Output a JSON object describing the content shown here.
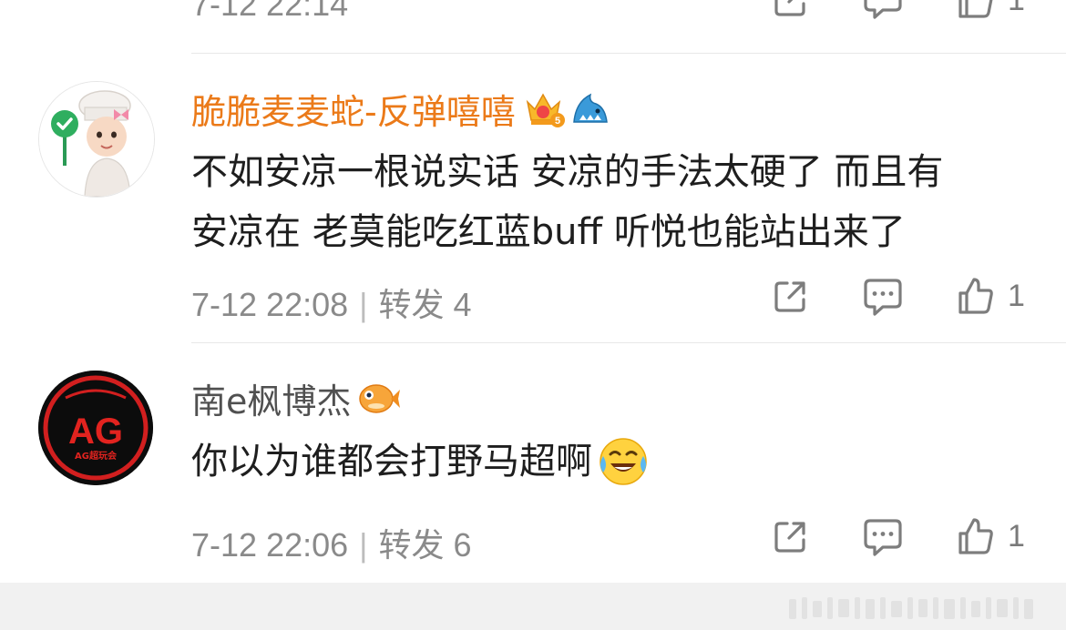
{
  "top_comment": {
    "time": "7-12 22:14",
    "likes": "1"
  },
  "comments": [
    {
      "username": "脆脆麦麦蛇-反弹嘻嘻",
      "username_color": "#eb7a19",
      "badges": [
        "crown-5-badge-icon",
        "shark-badge-icon"
      ],
      "text_line1": "不如安凉一根说实话 安凉的手法太硬了 而且有",
      "text_line2": "安凉在 老莫能吃红蓝buff 听悦也能站出来了",
      "time": "7-12 22:08",
      "repost_label": "转发 4",
      "likes": "1"
    },
    {
      "username": "南e枫博杰",
      "username_color": "#505050",
      "badges": [
        "pufferfish-badge-icon"
      ],
      "text": "你以为谁都会打野马超啊",
      "emoji": "laugh-cry-emoji-icon",
      "time": "7-12 22:06",
      "repost_label": "转发 6",
      "likes": "1",
      "avatar_logo_text": "AG",
      "avatar_sub_text": "AG超玩会"
    }
  ],
  "colors": {
    "divider": "#e8e8e8",
    "meta_gray": "#8a8a8a",
    "icon_gray": "#7d7d7d",
    "footer": "#f1f1f1"
  }
}
